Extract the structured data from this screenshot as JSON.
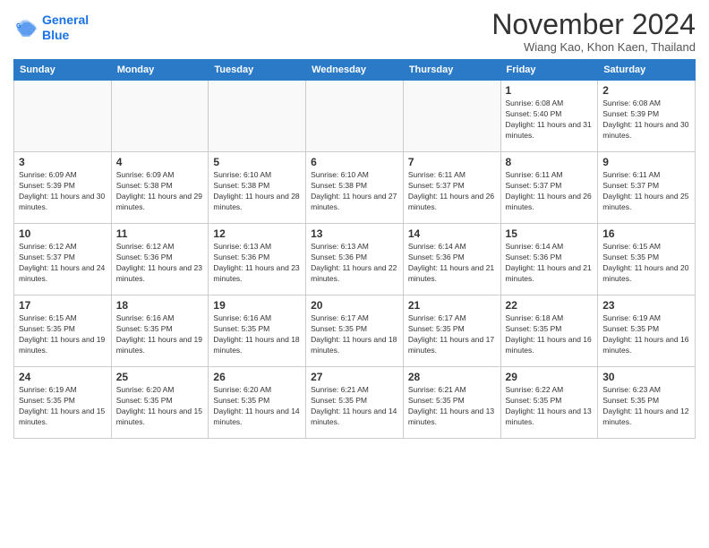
{
  "header": {
    "logo_line1": "General",
    "logo_line2": "Blue",
    "month": "November 2024",
    "location": "Wiang Kao, Khon Kaen, Thailand"
  },
  "weekdays": [
    "Sunday",
    "Monday",
    "Tuesday",
    "Wednesday",
    "Thursday",
    "Friday",
    "Saturday"
  ],
  "weeks": [
    [
      {
        "day": "",
        "info": ""
      },
      {
        "day": "",
        "info": ""
      },
      {
        "day": "",
        "info": ""
      },
      {
        "day": "",
        "info": ""
      },
      {
        "day": "",
        "info": ""
      },
      {
        "day": "1",
        "info": "Sunrise: 6:08 AM\nSunset: 5:40 PM\nDaylight: 11 hours and 31 minutes."
      },
      {
        "day": "2",
        "info": "Sunrise: 6:08 AM\nSunset: 5:39 PM\nDaylight: 11 hours and 30 minutes."
      }
    ],
    [
      {
        "day": "3",
        "info": "Sunrise: 6:09 AM\nSunset: 5:39 PM\nDaylight: 11 hours and 30 minutes."
      },
      {
        "day": "4",
        "info": "Sunrise: 6:09 AM\nSunset: 5:38 PM\nDaylight: 11 hours and 29 minutes."
      },
      {
        "day": "5",
        "info": "Sunrise: 6:10 AM\nSunset: 5:38 PM\nDaylight: 11 hours and 28 minutes."
      },
      {
        "day": "6",
        "info": "Sunrise: 6:10 AM\nSunset: 5:38 PM\nDaylight: 11 hours and 27 minutes."
      },
      {
        "day": "7",
        "info": "Sunrise: 6:11 AM\nSunset: 5:37 PM\nDaylight: 11 hours and 26 minutes."
      },
      {
        "day": "8",
        "info": "Sunrise: 6:11 AM\nSunset: 5:37 PM\nDaylight: 11 hours and 26 minutes."
      },
      {
        "day": "9",
        "info": "Sunrise: 6:11 AM\nSunset: 5:37 PM\nDaylight: 11 hours and 25 minutes."
      }
    ],
    [
      {
        "day": "10",
        "info": "Sunrise: 6:12 AM\nSunset: 5:37 PM\nDaylight: 11 hours and 24 minutes."
      },
      {
        "day": "11",
        "info": "Sunrise: 6:12 AM\nSunset: 5:36 PM\nDaylight: 11 hours and 23 minutes."
      },
      {
        "day": "12",
        "info": "Sunrise: 6:13 AM\nSunset: 5:36 PM\nDaylight: 11 hours and 23 minutes."
      },
      {
        "day": "13",
        "info": "Sunrise: 6:13 AM\nSunset: 5:36 PM\nDaylight: 11 hours and 22 minutes."
      },
      {
        "day": "14",
        "info": "Sunrise: 6:14 AM\nSunset: 5:36 PM\nDaylight: 11 hours and 21 minutes."
      },
      {
        "day": "15",
        "info": "Sunrise: 6:14 AM\nSunset: 5:36 PM\nDaylight: 11 hours and 21 minutes."
      },
      {
        "day": "16",
        "info": "Sunrise: 6:15 AM\nSunset: 5:35 PM\nDaylight: 11 hours and 20 minutes."
      }
    ],
    [
      {
        "day": "17",
        "info": "Sunrise: 6:15 AM\nSunset: 5:35 PM\nDaylight: 11 hours and 19 minutes."
      },
      {
        "day": "18",
        "info": "Sunrise: 6:16 AM\nSunset: 5:35 PM\nDaylight: 11 hours and 19 minutes."
      },
      {
        "day": "19",
        "info": "Sunrise: 6:16 AM\nSunset: 5:35 PM\nDaylight: 11 hours and 18 minutes."
      },
      {
        "day": "20",
        "info": "Sunrise: 6:17 AM\nSunset: 5:35 PM\nDaylight: 11 hours and 18 minutes."
      },
      {
        "day": "21",
        "info": "Sunrise: 6:17 AM\nSunset: 5:35 PM\nDaylight: 11 hours and 17 minutes."
      },
      {
        "day": "22",
        "info": "Sunrise: 6:18 AM\nSunset: 5:35 PM\nDaylight: 11 hours and 16 minutes."
      },
      {
        "day": "23",
        "info": "Sunrise: 6:19 AM\nSunset: 5:35 PM\nDaylight: 11 hours and 16 minutes."
      }
    ],
    [
      {
        "day": "24",
        "info": "Sunrise: 6:19 AM\nSunset: 5:35 PM\nDaylight: 11 hours and 15 minutes."
      },
      {
        "day": "25",
        "info": "Sunrise: 6:20 AM\nSunset: 5:35 PM\nDaylight: 11 hours and 15 minutes."
      },
      {
        "day": "26",
        "info": "Sunrise: 6:20 AM\nSunset: 5:35 PM\nDaylight: 11 hours and 14 minutes."
      },
      {
        "day": "27",
        "info": "Sunrise: 6:21 AM\nSunset: 5:35 PM\nDaylight: 11 hours and 14 minutes."
      },
      {
        "day": "28",
        "info": "Sunrise: 6:21 AM\nSunset: 5:35 PM\nDaylight: 11 hours and 13 minutes."
      },
      {
        "day": "29",
        "info": "Sunrise: 6:22 AM\nSunset: 5:35 PM\nDaylight: 11 hours and 13 minutes."
      },
      {
        "day": "30",
        "info": "Sunrise: 6:23 AM\nSunset: 5:35 PM\nDaylight: 11 hours and 12 minutes."
      }
    ]
  ]
}
